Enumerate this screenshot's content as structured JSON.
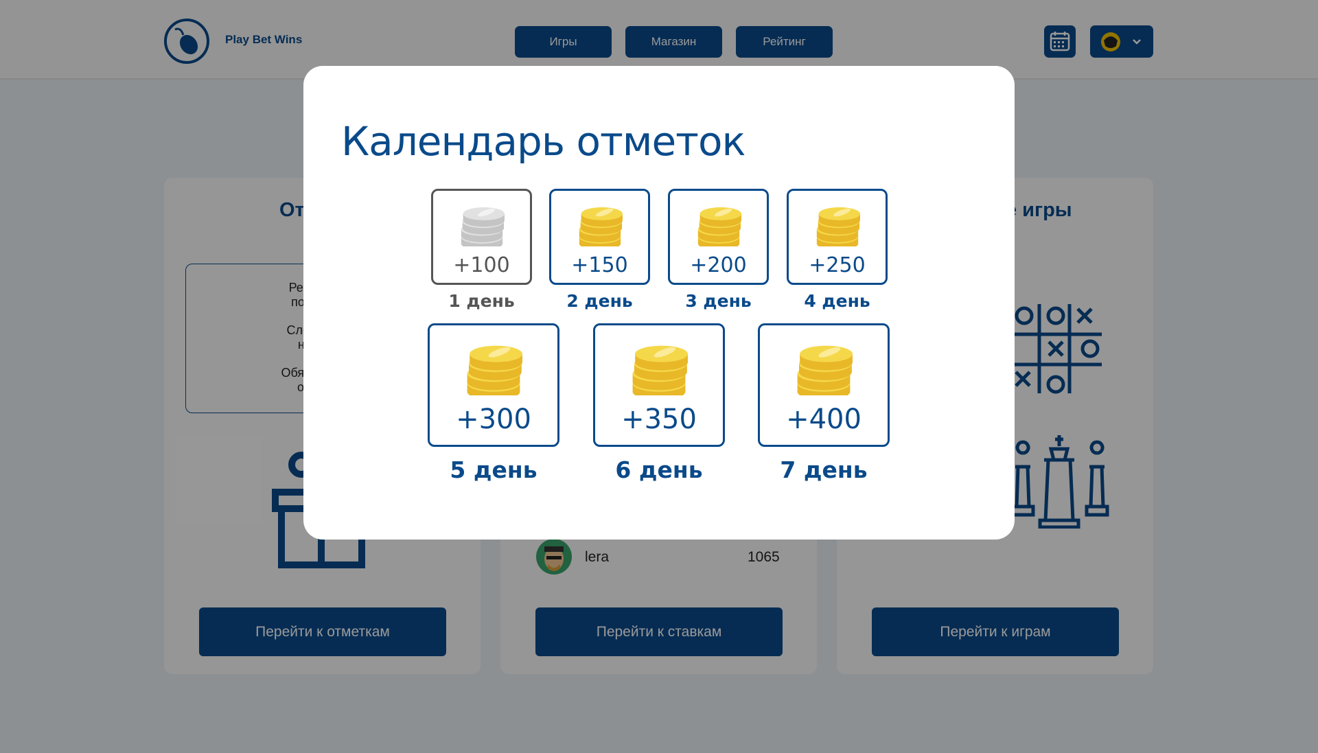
{
  "brand": {
    "name": "Play Bet Wins"
  },
  "nav": {
    "games": "Игры",
    "shop": "Магазин",
    "rating": "Рейтинг"
  },
  "cards": {
    "checkin": {
      "title": "От",
      "info": [
        "Регулярно зах",
        "получайте бо",
        "Следующая во",
        "награду уж",
        "Обязательно зах",
        "отметок и з"
      ],
      "button": "Перейти к отметкам"
    },
    "bets": {
      "leader_name": "lera",
      "leader_score": "1065",
      "button": "Перейти к ставкам"
    },
    "games": {
      "title": "е игры",
      "button": "Перейти к играм"
    }
  },
  "modal": {
    "title": "Календарь отметок",
    "days": [
      {
        "amount": "+100",
        "label": "1 день",
        "claimed": true
      },
      {
        "amount": "+150",
        "label": "2 день",
        "claimed": false
      },
      {
        "amount": "+200",
        "label": "3 день",
        "claimed": false
      },
      {
        "amount": "+250",
        "label": "4 день",
        "claimed": false
      },
      {
        "amount": "+300",
        "label": "5 день",
        "claimed": false
      },
      {
        "amount": "+350",
        "label": "6 день",
        "claimed": false
      },
      {
        "amount": "+400",
        "label": "7 день",
        "claimed": false
      }
    ]
  },
  "colors": {
    "primary": "#0a4a8a",
    "claimed": "#555555",
    "coin": "#f5d84a"
  },
  "icons": {
    "calendar": "calendar-icon",
    "avatar": "avatar",
    "chevron": "chevron-down-icon"
  }
}
